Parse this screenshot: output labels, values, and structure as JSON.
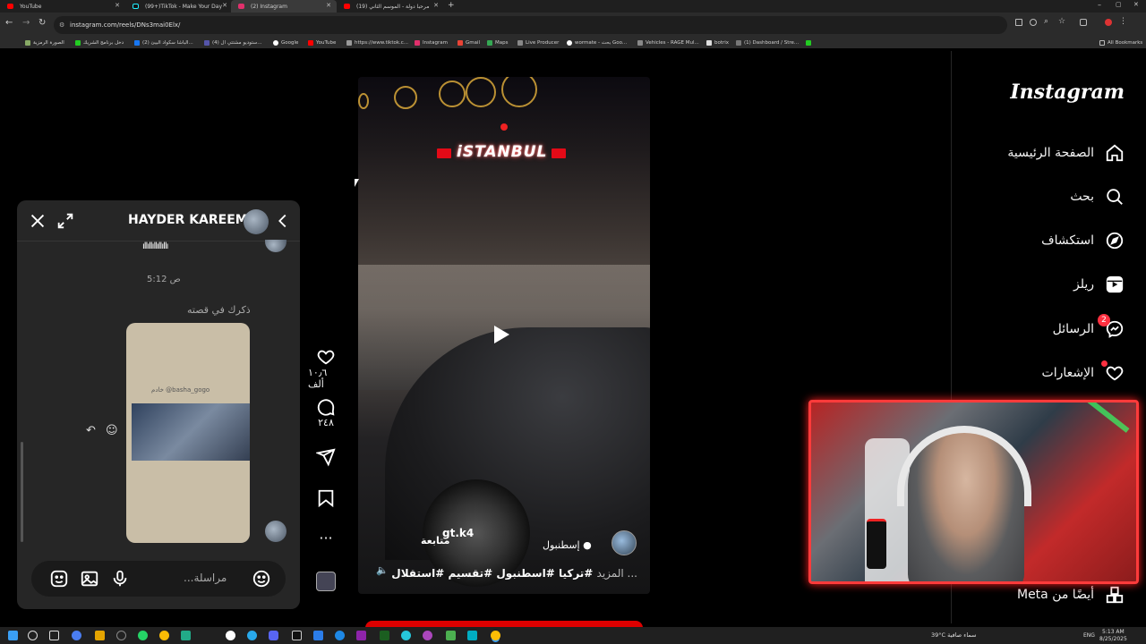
{
  "browser": {
    "tabs": [
      {
        "title": "YouTube",
        "color": "#ff0000"
      },
      {
        "title": "(99+)TikTok - Make Your Day",
        "color": "#111111"
      },
      {
        "title": "(2) Instagram",
        "color": "#e1306c"
      },
      {
        "title": "(19) مرحبا دولة - الموسم الثاني",
        "color": "#ff0000"
      }
    ],
    "url": "instagram.com/reels/DNs3mai0Elx/",
    "bookmarks": [
      "الصورة الرمزية",
      "دخل برنامج الشريك",
      "(2) الباشا سكواد البيئ...",
      "(4) ستوديو مشتتي ال...",
      "Google",
      "YouTube",
      "https://www.tiktok.c...",
      "Instagram",
      "Gmail",
      "Maps",
      "Live Producer",
      "wormate - بحث Goo...",
      "Vehicles - RAGE Mul...",
      "botrix",
      "(1) Dashboard / Stre..."
    ],
    "all_bookmarks": "All Bookmarks"
  },
  "instagram": {
    "logo": "Instagram",
    "nav": [
      {
        "label": "الصفحة الرئيسية",
        "icon": "home-icon"
      },
      {
        "label": "بحث",
        "icon": "search-icon"
      },
      {
        "label": "استكشاف",
        "icon": "compass-icon"
      },
      {
        "label": "ريلز",
        "icon": "reels-icon"
      },
      {
        "label": "الرسائل",
        "icon": "messenger-icon",
        "badge": "2"
      },
      {
        "label": "الإشعارات",
        "icon": "heart-icon"
      }
    ],
    "also_from_meta": "أيضًا من Meta"
  },
  "reel": {
    "overlay_text": "iSTANBUL",
    "username": "gt.k4",
    "follow": "متابعة",
    "location": "إسطنبول",
    "caption": "#تركيا #اسطنبول #تقسيم #استقلال",
    "more": "... المزيد",
    "likes": "١٠٫٦ ألف",
    "comments": "٢٤٨"
  },
  "chat": {
    "name": "HAYDER KAREEM",
    "time": "5:12 ص",
    "story_note": "ذكرك في قصته",
    "story_mention": "خادم @basha_gogo",
    "placeholder": "مراسلة..."
  },
  "taskbar": {
    "weather": "39°C سماء صافية",
    "lang": "ENG",
    "time": "5:13 AM",
    "date": "8/25/2025"
  }
}
